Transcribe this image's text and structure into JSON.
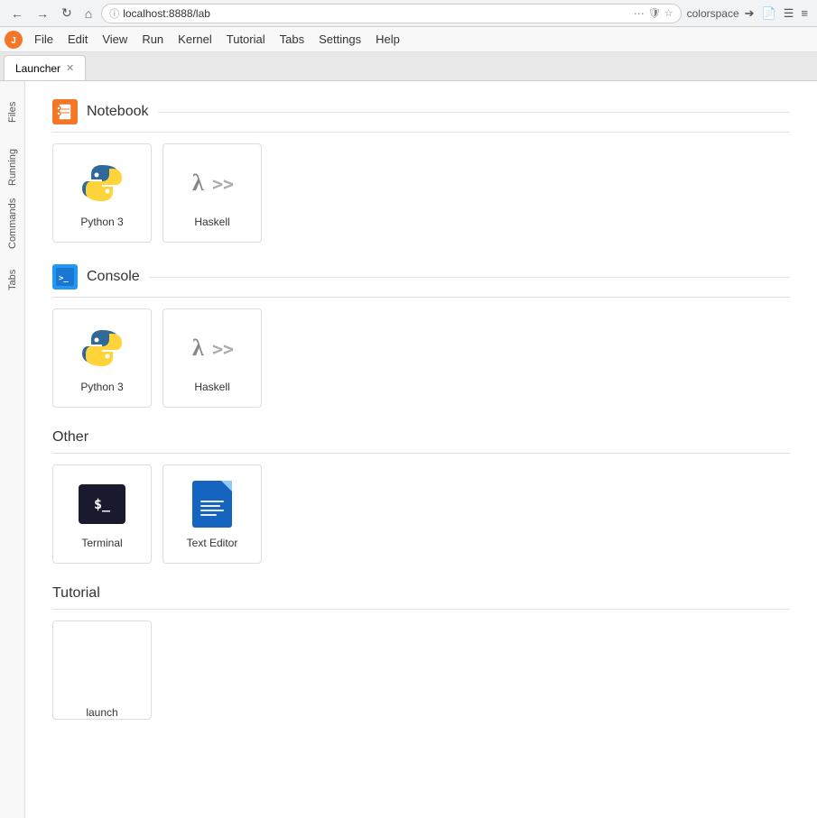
{
  "browser": {
    "url": "localhost:8888/lab",
    "search_placeholder": "colorspace",
    "back_disabled": false,
    "forward_disabled": false
  },
  "menubar": {
    "items": [
      "File",
      "Edit",
      "View",
      "Run",
      "Kernel",
      "Tutorial",
      "Tabs",
      "Settings",
      "Help"
    ]
  },
  "tabs": [
    {
      "label": "Launcher",
      "active": true
    }
  ],
  "sidebar": {
    "items": [
      {
        "label": "Files",
        "active": false
      },
      {
        "label": "Running",
        "active": false
      },
      {
        "label": "Commands",
        "active": false
      },
      {
        "label": "Tabs",
        "active": false
      }
    ]
  },
  "sections": {
    "notebook": {
      "title": "Notebook",
      "cards": [
        {
          "label": "Python 3",
          "type": "python"
        },
        {
          "label": "Haskell",
          "type": "haskell"
        }
      ]
    },
    "console": {
      "title": "Console",
      "cards": [
        {
          "label": "Python 3",
          "type": "python"
        },
        {
          "label": "Haskell",
          "type": "haskell"
        }
      ]
    },
    "other": {
      "title": "Other",
      "cards": [
        {
          "label": "Terminal",
          "type": "terminal"
        },
        {
          "label": "Text Editor",
          "type": "texteditor"
        }
      ]
    },
    "tutorial": {
      "title": "Tutorial",
      "cards": [
        {
          "label": "launch",
          "type": "launch"
        }
      ]
    }
  }
}
